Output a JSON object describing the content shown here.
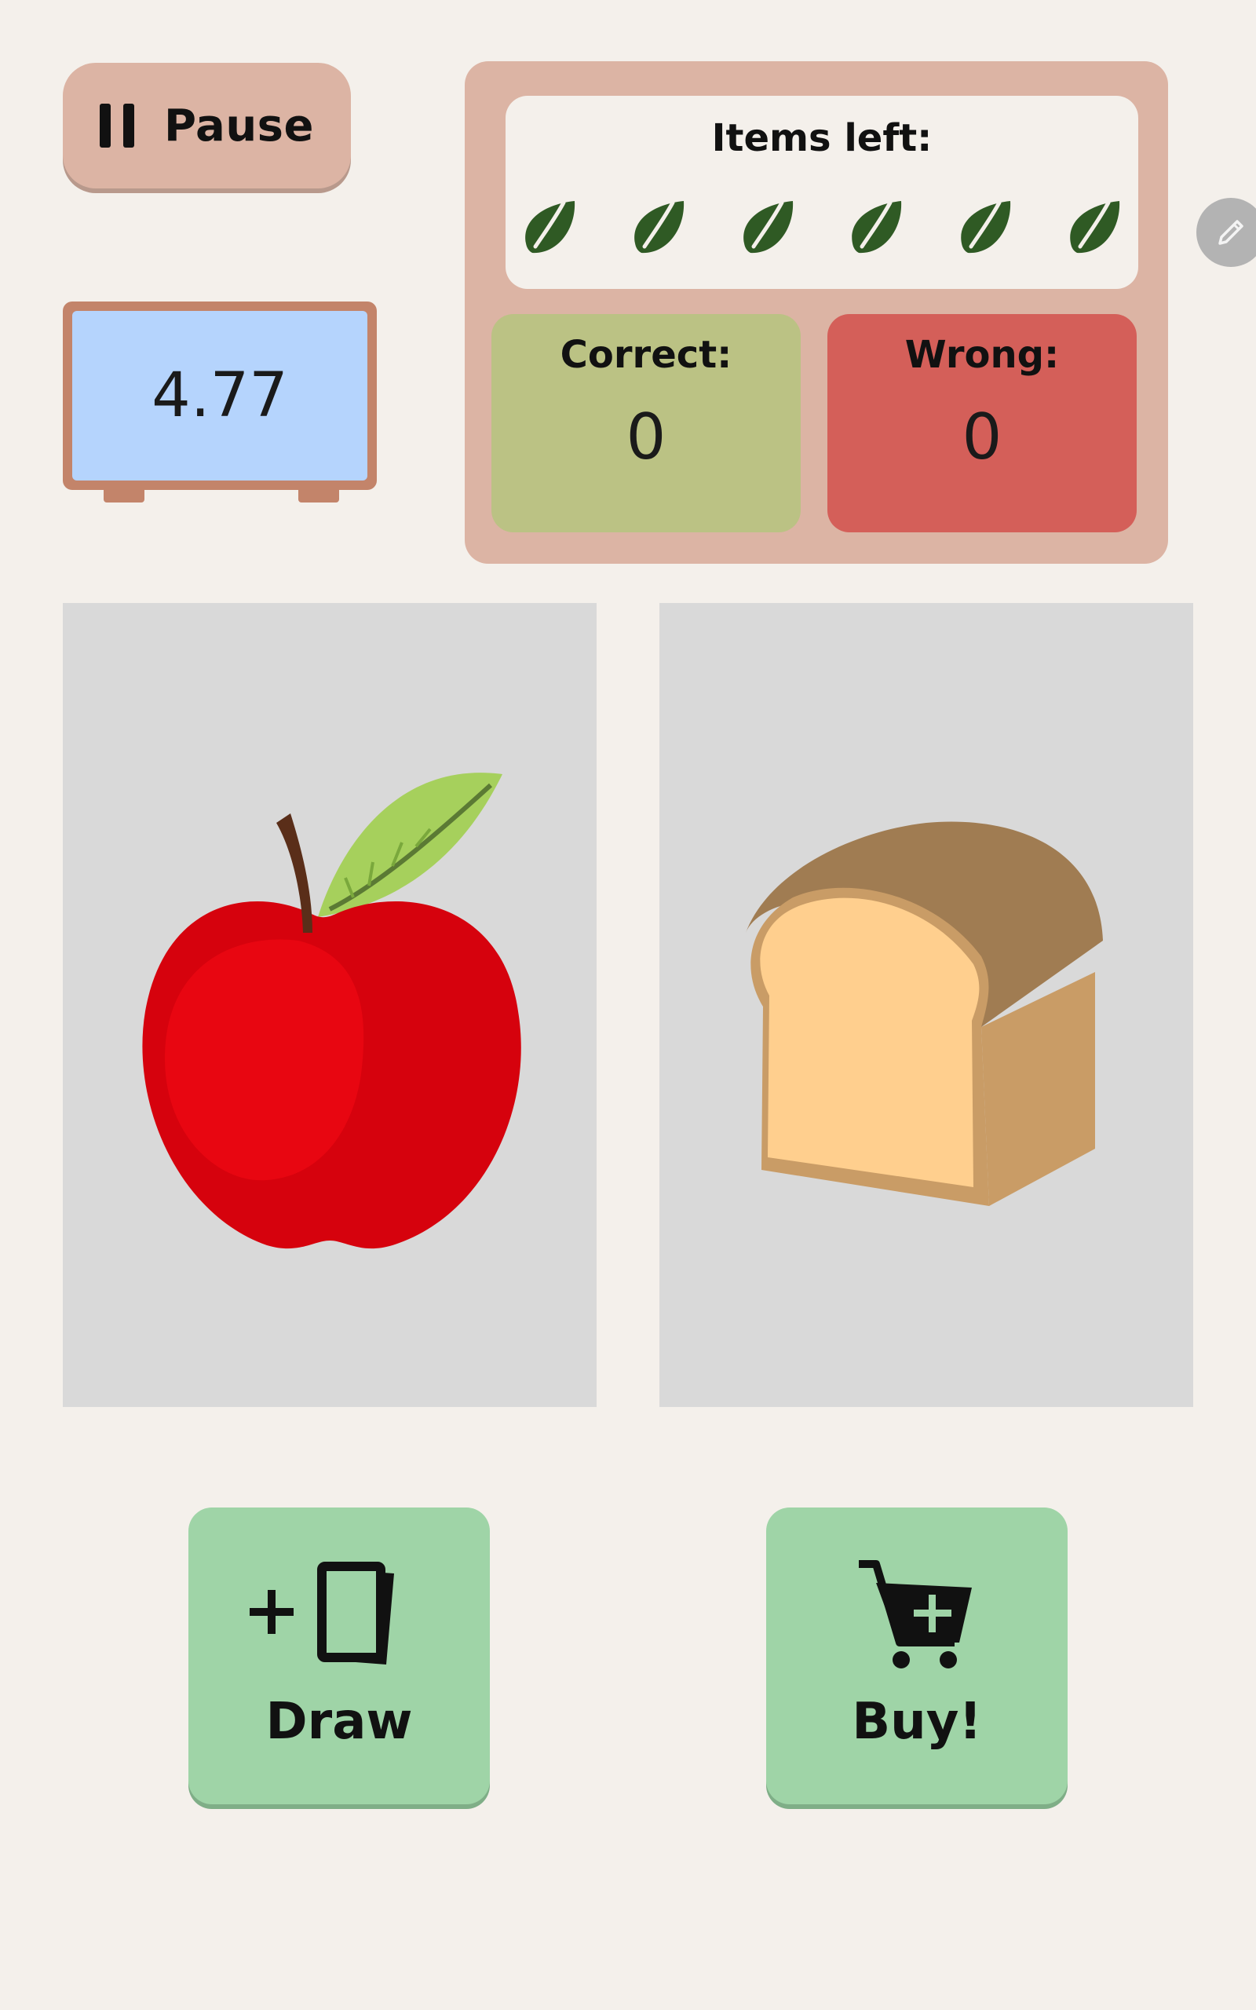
{
  "header": {
    "pause_label": "Pause"
  },
  "scale": {
    "value": "4.77"
  },
  "score_panel": {
    "items_left_label": "Items left:",
    "items_left_count": 6,
    "items_icon": "leaf-icon",
    "correct_label": "Correct:",
    "correct_value": "0",
    "wrong_label": "Wrong:",
    "wrong_value": "0"
  },
  "cards": [
    {
      "item": "apple",
      "icon": "apple-icon"
    },
    {
      "item": "bread",
      "icon": "bread-icon"
    }
  ],
  "actions": {
    "draw_label": "Draw",
    "buy_label": "Buy!"
  },
  "colors": {
    "background": "#f4f0eb",
    "panel": "#dcb4a4",
    "scale_screen": "#b5d4fd",
    "correct": "#bbc284",
    "wrong": "#d45f59",
    "action_button": "#9fd4a7",
    "card": "#d9d9d9",
    "leaf": "#2f5a24"
  }
}
